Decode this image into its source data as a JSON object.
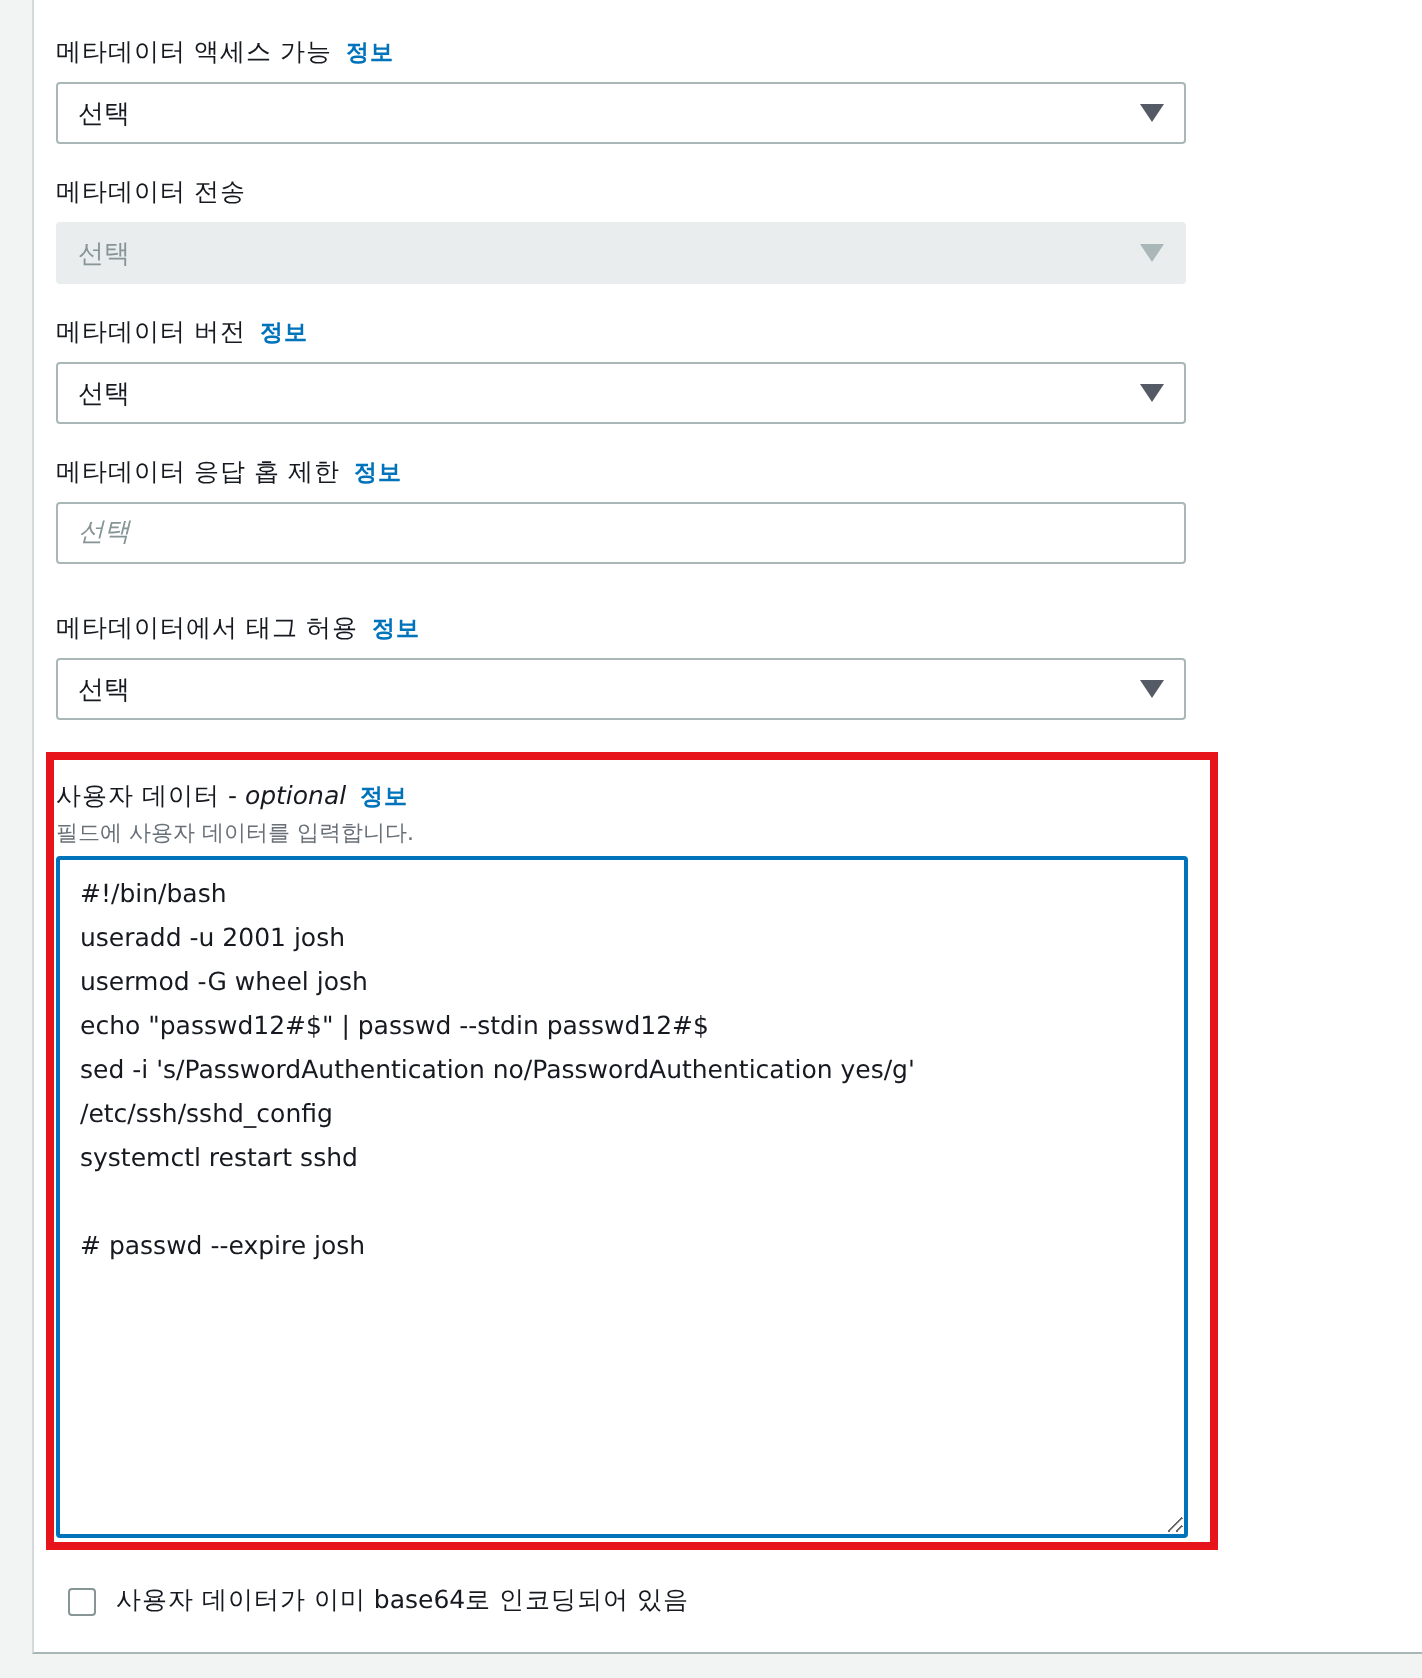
{
  "fields": [
    {
      "label": "메타데이터 액세스 가능",
      "info": "정보",
      "kind": "select",
      "value": "선택",
      "disabled": false
    },
    {
      "label": "메타데이터 전송",
      "kind": "select",
      "value": "선택",
      "disabled": true
    },
    {
      "label": "메타데이터 버전",
      "info": "정보",
      "kind": "select",
      "value": "선택",
      "disabled": false
    },
    {
      "label": "메타데이터 응답 홉 제한",
      "info": "정보",
      "kind": "input",
      "placeholder": "선택"
    },
    {
      "label": "메타데이터에서 태그 허용",
      "info": "정보",
      "kind": "select",
      "value": "선택",
      "disabled": false
    }
  ],
  "user_data": {
    "label": "사용자 데이터 - *optional*",
    "info": "정보",
    "description": "필드에 사용자 데이터를 입력합니다.",
    "highlighted": true,
    "lines": [
      "#!/bin/bash",
      "useradd -u 2001 josh",
      "usermod -G wheel josh",
      "echo \"passwd12#$\" | passwd --stdin passwd12#$",
      "sed -i 's/PasswordAuthentication no/PasswordAuthentication yes/g'",
      "/etc/ssh/sshd_config",
      "systemctl restart sshd"
    ],
    "comment_line": "# passwd --expire josh"
  },
  "base64_checkbox": {
    "label": "사용자 데이터가 이미 base64로 인코딩되어 있음",
    "checked": false
  }
}
